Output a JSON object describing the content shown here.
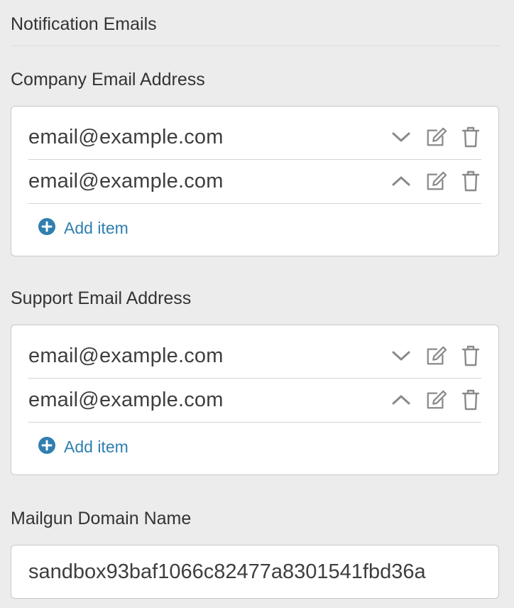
{
  "section": {
    "title": "Notification Emails"
  },
  "company_email": {
    "label": "Company Email Address",
    "items": [
      {
        "value": "email@example.com",
        "order_icon": "chevron-down-icon"
      },
      {
        "value": "email@example.com",
        "order_icon": "chevron-up-icon"
      }
    ],
    "add_label": "Add item"
  },
  "support_email": {
    "label": "Support Email Address",
    "items": [
      {
        "value": "email@example.com",
        "order_icon": "chevron-down-icon"
      },
      {
        "value": "email@example.com",
        "order_icon": "chevron-up-icon"
      }
    ],
    "add_label": "Add item"
  },
  "mailgun": {
    "label": "Mailgun Domain Name",
    "value": "sandbox93baf1066c82477a8301541fbd36a"
  },
  "colors": {
    "accent": "#2f7fb0",
    "icon": "#8a8a8a",
    "background": "#ececec"
  }
}
